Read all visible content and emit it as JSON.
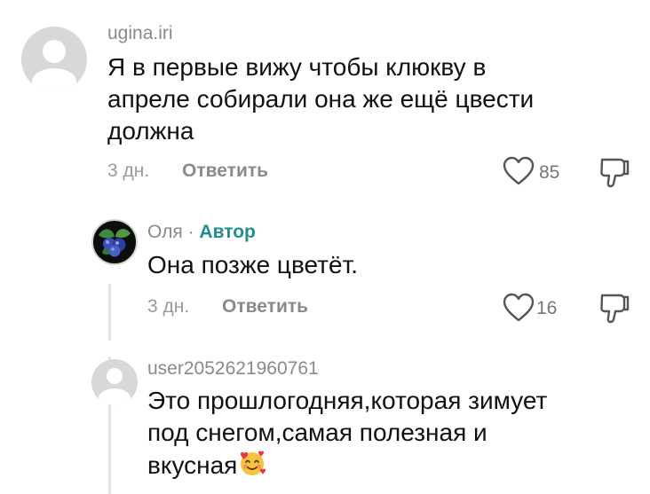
{
  "comments": [
    {
      "username": "ugina.iri",
      "text_lines": [
        "Я в первые вижу чтобы клюкву в",
        "апреле собирали она же ещё цвести",
        "должна"
      ],
      "time": "3 дн.",
      "reply_label": "Ответить",
      "likes": "85"
    },
    {
      "username": "Оля",
      "separator": " · ",
      "author_badge": "Автор",
      "text_lines": [
        "Она позже цветёт."
      ],
      "time": "3 дн.",
      "reply_label": "Ответить",
      "likes": "16"
    },
    {
      "username": "user2052621960761",
      "text_lines": [
        "Это прошлогодняя,которая зимует",
        "под снегом,самая полезная и",
        "вкусная"
      ],
      "emoji": "smiling-face-with-hearts"
    }
  ],
  "colors": {
    "text": "#111111",
    "meta": "#8a8a8a",
    "author_badge": "#1f8e8e",
    "avatar_default": "#d8d8d8",
    "thread_line": "#e4e4e4"
  },
  "icons": {
    "like": "heart-outline-icon",
    "dislike": "thumb-down-outline-icon"
  }
}
